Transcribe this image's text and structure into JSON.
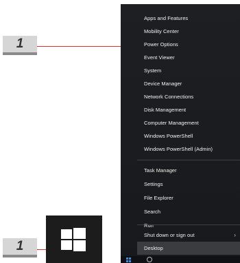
{
  "badges": [
    {
      "label": "1"
    },
    {
      "label": "1"
    }
  ],
  "menu": {
    "groups": [
      [
        "Apps and Features",
        "Mobility Center",
        "Power Options",
        "Event Viewer",
        "System",
        "Device Manager",
        "Network Connections",
        "Disk Management",
        "Computer Management",
        "Windows PowerShell",
        "Windows PowerShell (Admin)"
      ],
      [
        "Task Manager",
        "Settings",
        "File Explorer",
        "Search",
        "Run"
      ],
      [
        "Shut down or sign out",
        "Desktop"
      ]
    ],
    "highlighted_item": "Desktop",
    "submenu_icon": "chevron-right-icon"
  },
  "colors": {
    "menu_bg": "#1a1c1f",
    "menu_text": "#f2f2f2",
    "callout": "#d9342b",
    "start_tile": "#1c1c1c"
  },
  "icons": {
    "start": "windows-logo-icon"
  }
}
